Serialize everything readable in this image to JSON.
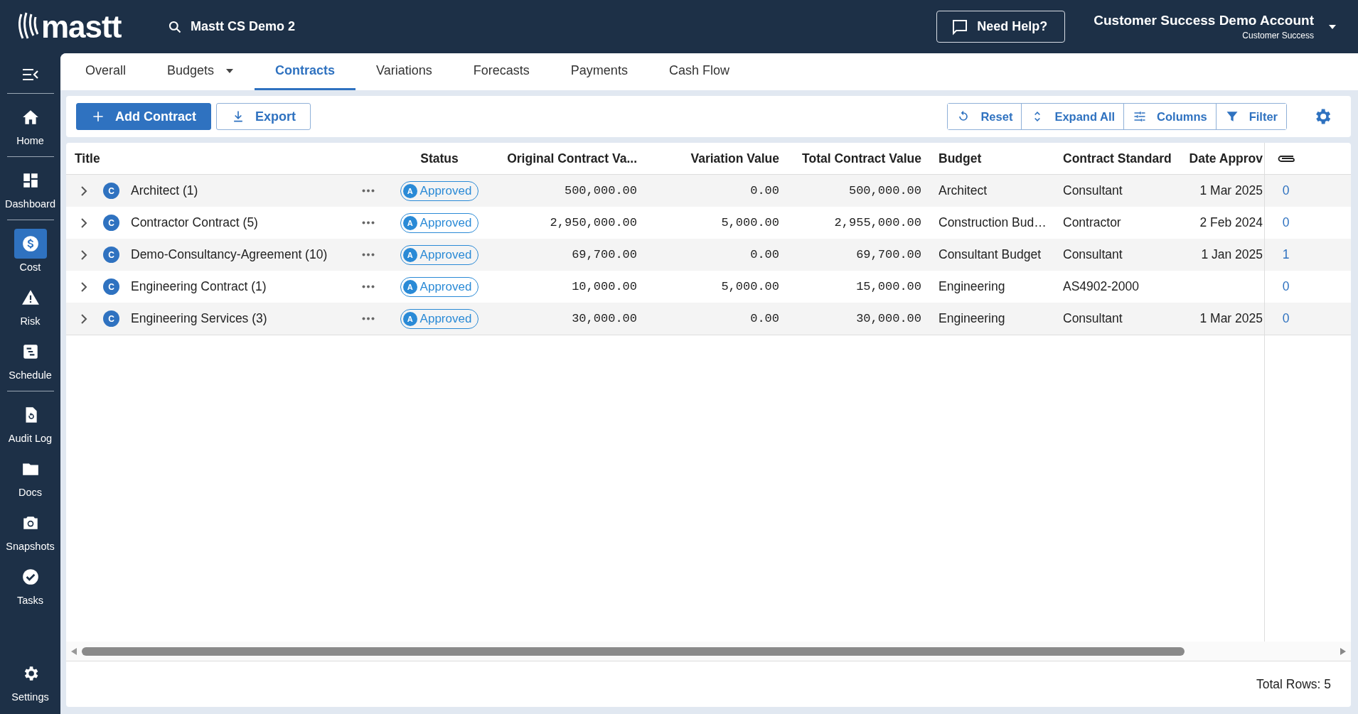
{
  "app": {
    "logo": "mastt",
    "project": "Mastt CS Demo 2",
    "help_button": "Need Help?",
    "account": {
      "name": "Customer Success Demo Account",
      "role": "Customer Success"
    }
  },
  "sidebar": {
    "groups": [
      {
        "items": [
          {
            "label": "Home",
            "selected": false
          }
        ]
      },
      {
        "items": [
          {
            "label": "Dashboard",
            "selected": false
          }
        ]
      },
      {
        "items": [
          {
            "label": "Cost",
            "selected": true
          },
          {
            "label": "Risk",
            "selected": false
          },
          {
            "label": "Schedule",
            "selected": false
          }
        ]
      },
      {
        "items": [
          {
            "label": "Audit Log",
            "selected": false
          },
          {
            "label": "Docs",
            "selected": false
          },
          {
            "label": "Snapshots",
            "selected": false
          },
          {
            "label": "Tasks",
            "selected": false
          }
        ]
      }
    ],
    "footer": {
      "label": "Settings",
      "selected": false
    }
  },
  "tabs": [
    {
      "label": "Overall",
      "selected": false,
      "dropdown": false
    },
    {
      "label": "Budgets",
      "selected": false,
      "dropdown": true
    },
    {
      "label": "Contracts",
      "selected": true,
      "dropdown": false
    },
    {
      "label": "Variations",
      "selected": false,
      "dropdown": false
    },
    {
      "label": "Forecasts",
      "selected": false,
      "dropdown": false
    },
    {
      "label": "Payments",
      "selected": false,
      "dropdown": false
    },
    {
      "label": "Cash Flow",
      "selected": false,
      "dropdown": false
    }
  ],
  "toolbar": {
    "actions": [
      {
        "label": "Add Contract",
        "kind": "primary"
      },
      {
        "label": "Export",
        "kind": "outline"
      }
    ],
    "view_controls": [
      {
        "label": "Reset"
      },
      {
        "label": "Expand All"
      },
      {
        "label": "Columns"
      },
      {
        "label": "Filter"
      }
    ]
  },
  "table": {
    "columns": [
      {
        "label": "Title"
      },
      {
        "label": "Status"
      },
      {
        "label": "Original Contract Va..."
      },
      {
        "label": "Variation Value"
      },
      {
        "label": "Total Contract Value"
      },
      {
        "label": "Budget"
      },
      {
        "label": "Contract Standard"
      },
      {
        "label": "Date Approv"
      }
    ],
    "rows": [
      {
        "title": "Architect (1)",
        "type_badge": "C",
        "status_badge": "A",
        "status": "Approved",
        "original": "500,000.00",
        "variation": "0.00",
        "total": "500,000.00",
        "budget": "Architect",
        "standard": "Consultant",
        "date": "1 Mar 2025",
        "attachments": "0"
      },
      {
        "title": "Contractor Contract (5)",
        "type_badge": "C",
        "status_badge": "A",
        "status": "Approved",
        "original": "2,950,000.00",
        "variation": "5,000.00",
        "total": "2,955,000.00",
        "budget": "Construction Bud…",
        "standard": "Contractor",
        "date": "2 Feb 2024",
        "attachments": "0"
      },
      {
        "title": "Demo-Consultancy-Agreement (10)",
        "type_badge": "C",
        "status_badge": "A",
        "status": "Approved",
        "original": "69,700.00",
        "variation": "0.00",
        "total": "69,700.00",
        "budget": "Consultant Budget",
        "standard": "Consultant",
        "date": "1 Jan 2025",
        "attachments": "1"
      },
      {
        "title": "Engineering Contract (1)",
        "type_badge": "C",
        "status_badge": "A",
        "status": "Approved",
        "original": "10,000.00",
        "variation": "5,000.00",
        "total": "15,000.00",
        "budget": "Engineering",
        "standard": "AS4902-2000",
        "date": "",
        "attachments": "0"
      },
      {
        "title": "Engineering Services (3)",
        "type_badge": "C",
        "status_badge": "A",
        "status": "Approved",
        "original": "30,000.00",
        "variation": "0.00",
        "total": "30,000.00",
        "budget": "Engineering",
        "standard": "Consultant",
        "date": "1 Mar 2025",
        "attachments": "0"
      }
    ]
  },
  "status_bar": {
    "total_rows": "Total Rows: 5"
  }
}
